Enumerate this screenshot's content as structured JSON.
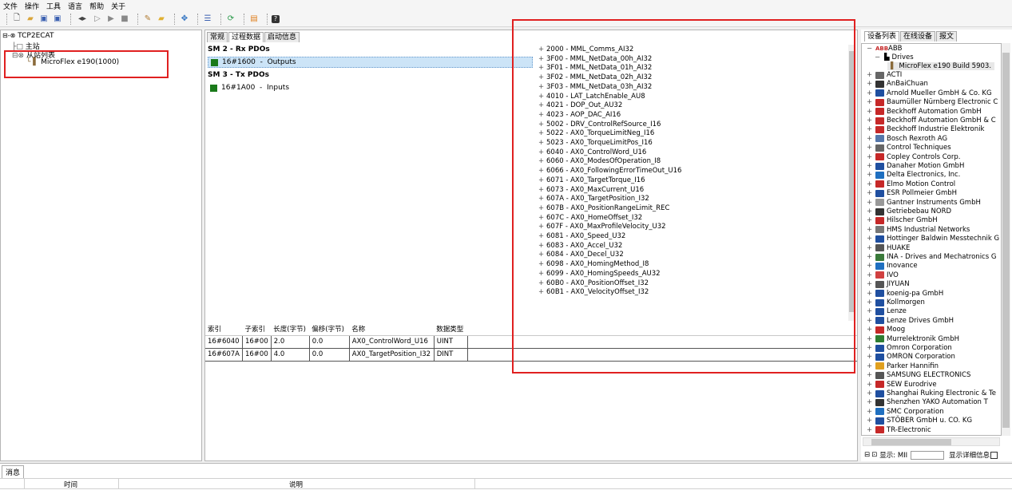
{
  "menu": [
    "文件",
    "操作",
    "工具",
    "语言",
    "帮助",
    "关于"
  ],
  "toolbar": {
    "icons": [
      "new-file-icon",
      "open-folder-icon",
      "save-icon",
      "save-all-icon",
      "step-icon",
      "play-icon",
      "run-icon",
      "stop-icon",
      "settings-icon",
      "folder-icon",
      "network-icon",
      "config-icon",
      "refresh-icon",
      "export-icon",
      "help-icon"
    ]
  },
  "project_tree": {
    "root": "TCP2ECAT",
    "master": "主站",
    "slaves": "从站列表",
    "device": "MicroFlex e190(1000)"
  },
  "pdo_panel": {
    "tabs": [
      "常规",
      "过程数据",
      "启动信息"
    ],
    "active_tab": "过程数据",
    "sm2_header": "SM 2 - Rx PDOs",
    "sm2_item": "16#1600  -  Outputs",
    "sm3_header": "SM 3 - Tx PDOs",
    "sm3_item": "16#1A00  -  Inputs",
    "object_entries": [
      "2000 - MML_Comms_AI32",
      "3F00 - MML_NetData_00h_AI32",
      "3F01 - MML_NetData_01h_AI32",
      "3F02 - MML_NetData_02h_AI32",
      "3F03 - MML_NetData_03h_AI32",
      "4010 - LAT_LatchEnable_AU8",
      "4021 - DOP_Out_AU32",
      "4023 - AOP_DAC_AI16",
      "5002 - DRV_ControlRefSource_I16",
      "5022 - AX0_TorqueLimitNeg_I16",
      "5023 - AX0_TorqueLimitPos_I16",
      "6040 - AX0_ControlWord_U16",
      "6060 - AX0_ModesOfOperation_I8",
      "6066 - AX0_FollowingErrorTimeOut_U16",
      "6071 - AX0_TargetTorque_I16",
      "6073 - AX0_MaxCurrent_U16",
      "607A - AX0_TargetPosition_I32",
      "607B - AX0_PositionRangeLimit_REC",
      "607C - AX0_HomeOffset_I32",
      "607F - AX0_MaxProfileVelocity_U32",
      "6081 - AX0_Speed_U32",
      "6083 - AX0_Accel_U32",
      "6084 - AX0_Decel_U32",
      "6098 - AX0_HomingMethod_I8",
      "6099 - AX0_HomingSpeeds_AU32",
      "60B0 - AX0_PositionOffset_I32",
      "60B1 - AX0_VelocityOffset_I32"
    ],
    "table": {
      "headers": [
        "索引",
        "子索引",
        "长度(字节)",
        "偏移(字节)",
        "名称",
        "数据类型"
      ],
      "rows": [
        [
          "16#6040",
          "16#00",
          "2.0",
          "0.0",
          "AX0_ControlWord_U16",
          "UINT"
        ],
        [
          "16#607A",
          "16#00",
          "4.0",
          "0.0",
          "AX0_TargetPosition_I32",
          "DINT"
        ]
      ]
    }
  },
  "device_panel": {
    "tabs": [
      "设备列表",
      "在线设备",
      "报文"
    ],
    "abb": "ABB",
    "drives": "Drives",
    "selected_device": "MicroFlex e190 Build 5903.",
    "vendors": [
      {
        "name": "ACTI",
        "color": "#666666"
      },
      {
        "name": "AnBaiChuan",
        "color": "#333333"
      },
      {
        "name": "Arnold Mueller GmbH & Co. KG",
        "color": "#1f4fa0"
      },
      {
        "name": "Baumüller Nürnberg Electronic C",
        "color": "#c62828"
      },
      {
        "name": "Beckhoff Automation GmbH",
        "color": "#c62828"
      },
      {
        "name": "Beckhoff Automation GmbH & C",
        "color": "#c62828"
      },
      {
        "name": "Beckhoff Industrie Elektronik",
        "color": "#c62828"
      },
      {
        "name": "Bosch Rexroth AG",
        "color": "#5577aa"
      },
      {
        "name": "Control Techniques",
        "color": "#666666"
      },
      {
        "name": "Copley Controls Corp.",
        "color": "#c62828"
      },
      {
        "name": "Danaher Motion GmbH",
        "color": "#1f4fa0"
      },
      {
        "name": "Delta Electronics, Inc.",
        "color": "#1f6fc0"
      },
      {
        "name": "Elmo Motion Control",
        "color": "#c62828"
      },
      {
        "name": "ESR Pollmeier GmbH",
        "color": "#1f4fa0"
      },
      {
        "name": "Gantner Instruments GmbH",
        "color": "#999999"
      },
      {
        "name": "Getriebebau NORD",
        "color": "#333333"
      },
      {
        "name": "Hilscher GmbH",
        "color": "#c62828"
      },
      {
        "name": "HMS Industrial Networks",
        "color": "#777777"
      },
      {
        "name": "Hottinger Baldwin Messtechnik G",
        "color": "#1f4fa0"
      },
      {
        "name": "HUAKE",
        "color": "#555555"
      },
      {
        "name": "INA - Drives and Mechatronics G",
        "color": "#3a7a3a"
      },
      {
        "name": "Inovance",
        "color": "#1f6fc0"
      },
      {
        "name": "IVO",
        "color": "#d04040"
      },
      {
        "name": "JIYUAN",
        "color": "#555555"
      },
      {
        "name": "koenig-pa GmbH",
        "color": "#1f4fa0"
      },
      {
        "name": "Kollmorgen",
        "color": "#1f4fa0"
      },
      {
        "name": "Lenze",
        "color": "#1f4fa0"
      },
      {
        "name": "Lenze Drives GmbH",
        "color": "#1f4fa0"
      },
      {
        "name": "Moog",
        "color": "#c62828"
      },
      {
        "name": "Murrelektronik GmbH",
        "color": "#2e7d32"
      },
      {
        "name": "Omron Corporation",
        "color": "#1f4fa0"
      },
      {
        "name": "OMRON Corporation",
        "color": "#1f4fa0"
      },
      {
        "name": "Parker Hannifin",
        "color": "#e0a020"
      },
      {
        "name": "SAMSUNG ELECTRONICS",
        "color": "#555555"
      },
      {
        "name": "SEW Eurodrive",
        "color": "#c62828"
      },
      {
        "name": "Shanghai Ruking Electronic & Te",
        "color": "#1f4fa0"
      },
      {
        "name": "Shenzhen  YAKO  Automation  T",
        "color": "#333333"
      },
      {
        "name": "SMC Corporation",
        "color": "#1f6fc0"
      },
      {
        "name": "STÖBER GmbH u. CO. KG",
        "color": "#1f4fa0"
      },
      {
        "name": "TR-Electronic",
        "color": "#c62828"
      }
    ],
    "status_show": "显示: MII",
    "status_detail": "显示详细信息"
  },
  "messages": {
    "tab": "消息",
    "col_time": "时间",
    "col_desc": "说明"
  },
  "highlight_color": "#e02020"
}
